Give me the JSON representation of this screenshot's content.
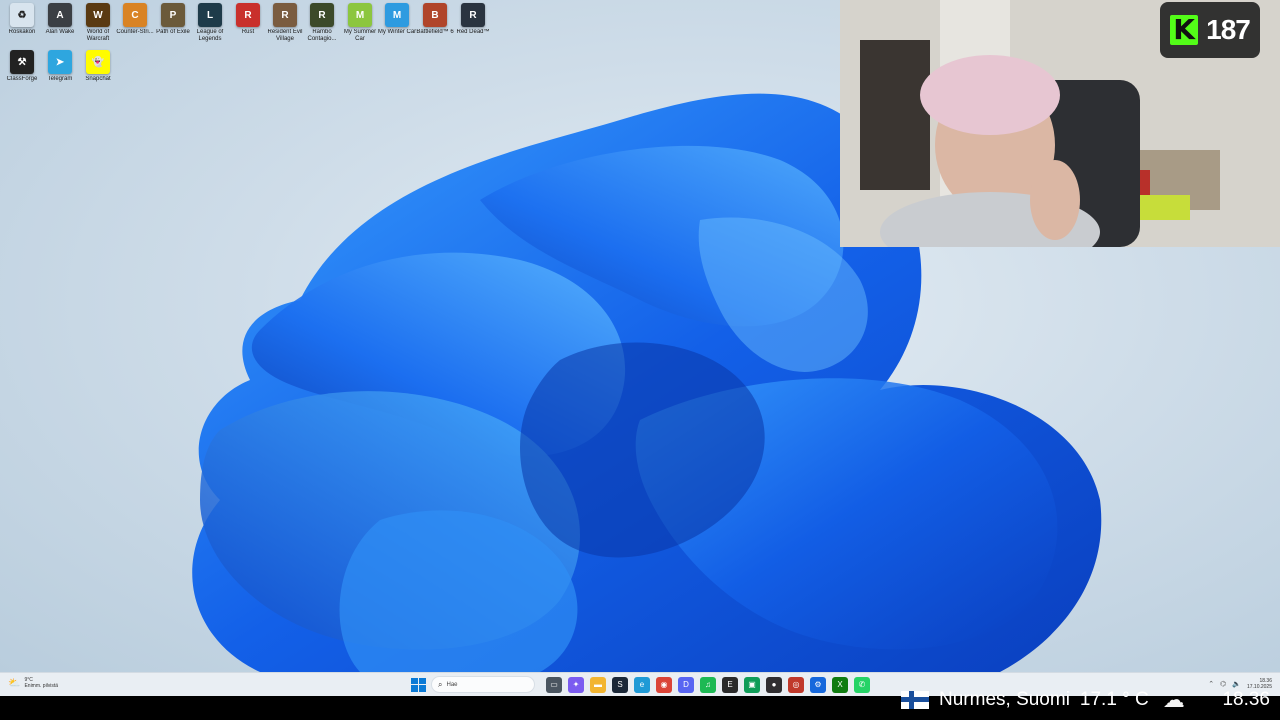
{
  "desktop_icons": [
    {
      "label": "Roskakori",
      "icon": "recycle-bin-icon",
      "color": "#d8e4ee",
      "glyph": "♻"
    },
    {
      "label": "Alan Wake",
      "icon": "alan-wake-icon",
      "color": "#3b3f44",
      "glyph": "A"
    },
    {
      "label": "World of Warcraft",
      "icon": "wow-icon",
      "color": "#5a3a12",
      "glyph": "W"
    },
    {
      "label": "Counter-Stri...",
      "icon": "counter-strike-icon",
      "color": "#d98324",
      "glyph": "C"
    },
    {
      "label": "Path of Exile",
      "icon": "path-of-exile-icon",
      "color": "#6b5a3a",
      "glyph": "P"
    },
    {
      "label": "League of Legends",
      "icon": "league-icon",
      "color": "#1e3b4a",
      "glyph": "L"
    },
    {
      "label": "Rust",
      "icon": "rust-icon",
      "color": "#c9302c",
      "glyph": "R"
    },
    {
      "label": "Resident Evil Village",
      "icon": "resident-evil-icon",
      "color": "#7a5c40",
      "glyph": "R"
    },
    {
      "label": "Rambo Contagio...",
      "icon": "rambo-icon",
      "color": "#3c4a2a",
      "glyph": "R"
    },
    {
      "label": "My Summer Car",
      "icon": "my-summer-car-icon",
      "color": "#8cc63f",
      "glyph": "M"
    },
    {
      "label": "My Winter Car",
      "icon": "my-winter-car-icon",
      "color": "#2e9be0",
      "glyph": "M"
    },
    {
      "label": "Battlefield™ 6",
      "icon": "battlefield-icon",
      "color": "#b0452a",
      "glyph": "B"
    },
    {
      "label": "Red Dead™",
      "icon": "red-dead-icon",
      "color": "#2a3440",
      "glyph": "R"
    },
    {
      "label": "ClassForge",
      "icon": "classforge-icon",
      "color": "#222222",
      "glyph": "⚒"
    },
    {
      "label": "Telegram",
      "icon": "telegram-icon",
      "color": "#2ea6df",
      "glyph": "➤"
    },
    {
      "label": "Snapchat",
      "icon": "snapchat-icon",
      "color": "#fffc00",
      "glyph": "👻"
    }
  ],
  "webcam": {
    "viewer_count": "187",
    "platform_logo": "K",
    "accent": "#53fc18"
  },
  "taskbar": {
    "weather_temp": "9°C",
    "weather_desc": "Enimm. pilvistä",
    "search_placeholder": "Hae",
    "apps": [
      {
        "icon": "task-view-icon",
        "color": "#4a5560",
        "glyph": "▭"
      },
      {
        "icon": "copilot-icon",
        "color": "#7b5cf0",
        "glyph": "✦"
      },
      {
        "icon": "file-explorer-icon",
        "color": "#f2b531",
        "glyph": "▬"
      },
      {
        "icon": "steam-icon",
        "color": "#1b2838",
        "glyph": "S"
      },
      {
        "icon": "edge-icon",
        "color": "#1f9ad6",
        "glyph": "e"
      },
      {
        "icon": "chrome-icon",
        "color": "#db4437",
        "glyph": "◉"
      },
      {
        "icon": "discord-icon",
        "color": "#5865f2",
        "glyph": "D"
      },
      {
        "icon": "spotify-icon",
        "color": "#1db954",
        "glyph": "♫"
      },
      {
        "icon": "epic-icon",
        "color": "#2a2a2a",
        "glyph": "E"
      },
      {
        "icon": "store-icon",
        "color": "#0f9d58",
        "glyph": "▣"
      },
      {
        "icon": "obs-icon",
        "color": "#302e31",
        "glyph": "●"
      },
      {
        "icon": "capture-icon",
        "color": "#c0392b",
        "glyph": "◎"
      },
      {
        "icon": "app-blue-icon",
        "color": "#1668dc",
        "glyph": "⚙"
      },
      {
        "icon": "xbox-icon",
        "color": "#107c10",
        "glyph": "X"
      },
      {
        "icon": "whatsapp-icon",
        "color": "#25d366",
        "glyph": "✆"
      }
    ],
    "clock_time": "18.36",
    "clock_date": "17.10.2025"
  },
  "info": {
    "location": "Nurmes, Suomi",
    "temperature": "17.1 ° C",
    "weather_icon": "cloud-icon",
    "time": "18.36"
  }
}
